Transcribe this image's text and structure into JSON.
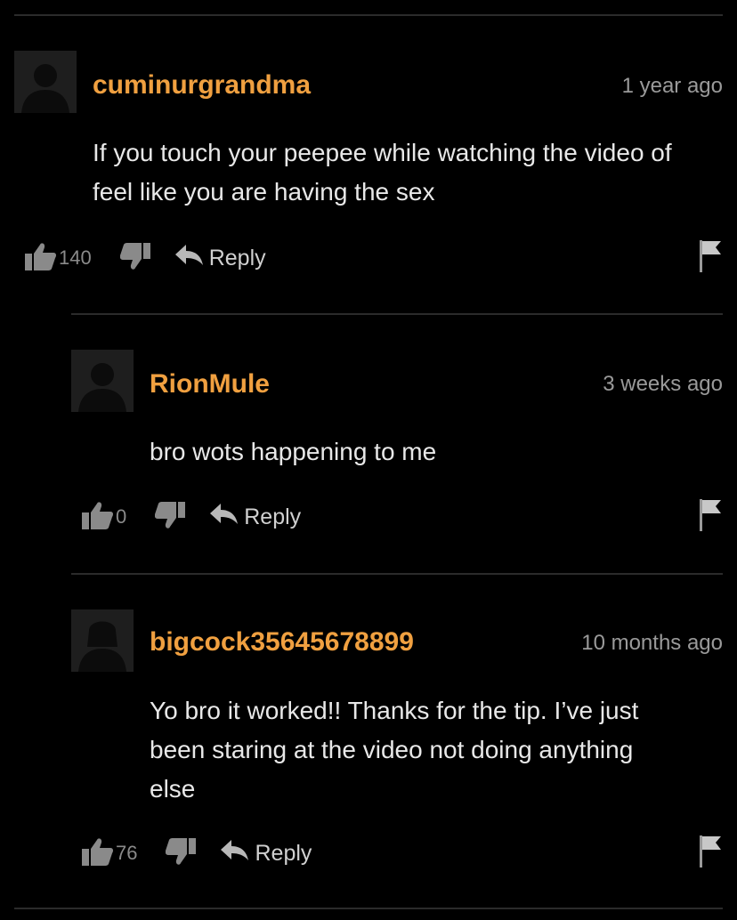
{
  "comments": [
    {
      "username": "cuminurgrandma",
      "timestamp": "1 year ago",
      "text_lines": [
        "If you touch your peepee while watching the video of",
        "feel like you are having the sex"
      ],
      "likes": "140",
      "reply_label": "Reply"
    },
    {
      "username": "RionMule",
      "timestamp": "3 weeks ago",
      "text_lines": [
        "bro wots happening to me"
      ],
      "likes": "0",
      "reply_label": "Reply"
    },
    {
      "username": "bigcock35645678899",
      "timestamp": "10 months ago",
      "text_lines": [
        "Yo bro it worked!! Thanks for the tip. I’ve just",
        "been staring at the video not doing anything",
        "else"
      ],
      "likes": "76",
      "reply_label": "Reply"
    }
  ],
  "icons": {
    "avatar": "avatar-placeholder-icon",
    "like": "thumbs-up-icon",
    "dislike": "thumbs-down-icon",
    "reply": "reply-arrow-icon",
    "flag": "flag-icon"
  },
  "colors": {
    "background": "#000000",
    "username": "#f0a040",
    "text": "#e8e8e8",
    "muted": "#9a9a9a"
  }
}
